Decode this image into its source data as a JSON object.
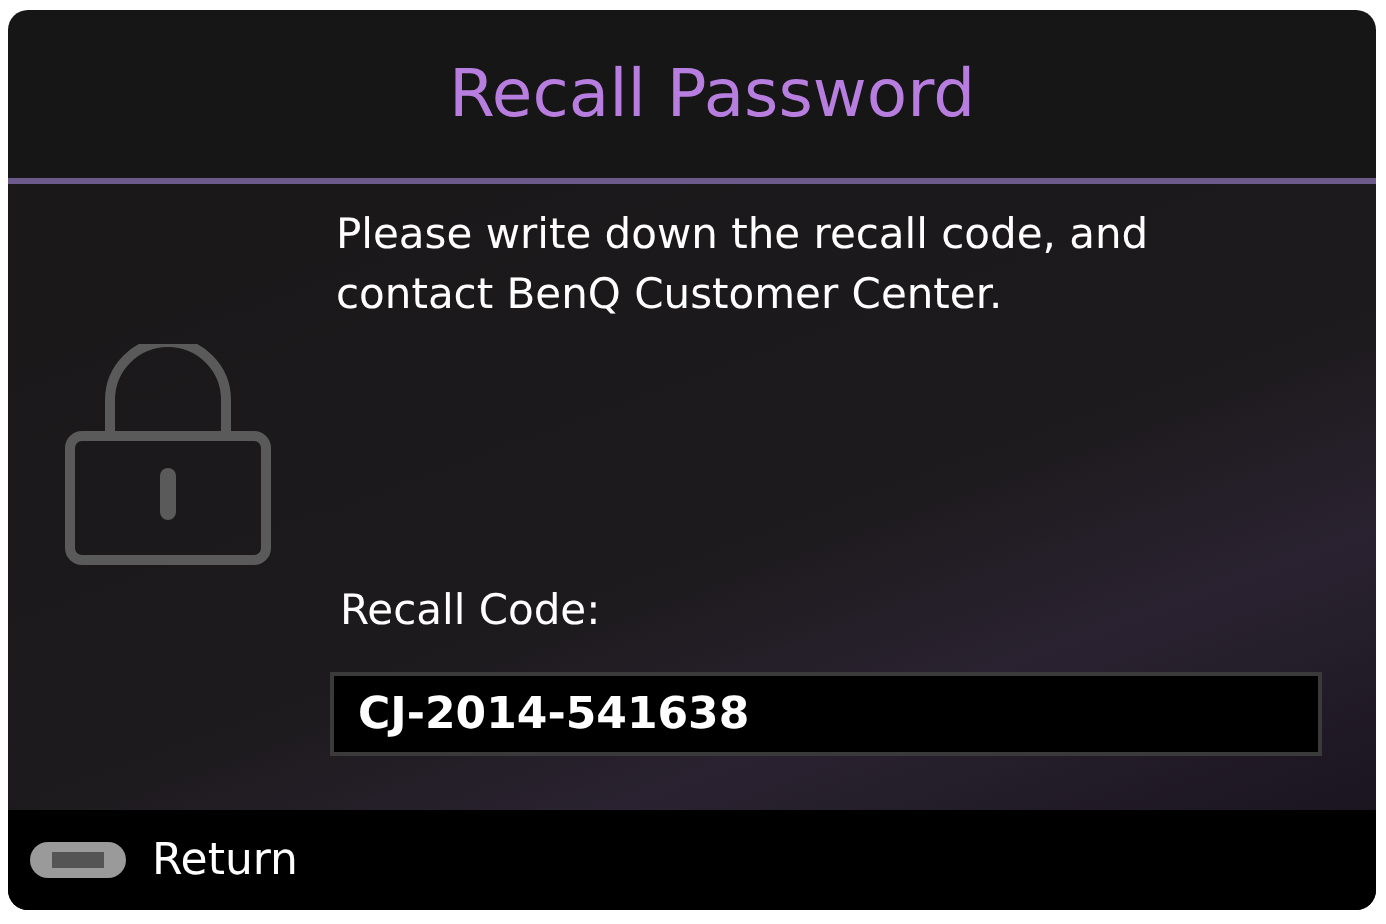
{
  "dialog": {
    "title": "Recall Password",
    "message": "Please write down the recall code, and contact BenQ Customer Center.",
    "recall_code": {
      "label": "Recall Code:",
      "value": "CJ-2014-541638"
    }
  },
  "footer": {
    "hint": "Return"
  }
}
